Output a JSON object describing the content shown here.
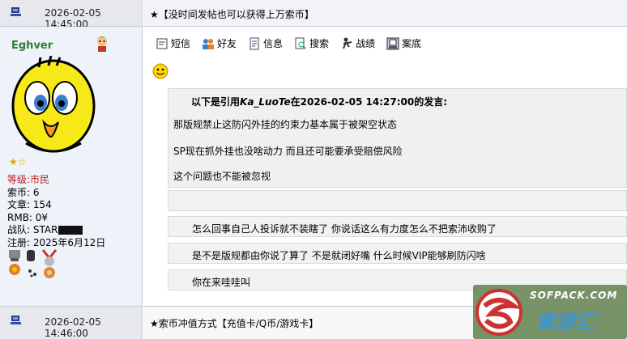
{
  "post1": {
    "date": "2026-02-05 14:45:00",
    "title": "★【没时间发帖也可以获得上万索币】"
  },
  "user": {
    "name": "Eghver",
    "level_label": "等级:",
    "level_value": "市民",
    "coins": "索币: 6",
    "articles": "文章: 154",
    "rmb": "RMB: 0¥",
    "clan": "战队: STAR",
    "joined": "注册: 2025年6月12日"
  },
  "toolbar": {
    "message": "短信",
    "friend": "好友",
    "info": "信息",
    "search": "搜索",
    "record": "战绩",
    "archive": "案底"
  },
  "quote": {
    "header_prefix": "以下是引用",
    "author": "Ka_LuoTe",
    "header_suffix": "在2026-02-05 14:27:00的发言:",
    "line1": "那版规禁止这防闪外挂的约束力基本属于被架空状态",
    "line2": "SP现在抓外挂也没啥动力  而且还可能要承受赔偿风险",
    "line3": "这个问题也不能被忽视"
  },
  "replies": {
    "r1": "怎么回事自己人投诉就不装瞎了 你说话这么有力度怎么不把索沛收购了",
    "r2": "是不是版规都由你说了算了 不是就闭好嘴 什么时候VIP能够刷防闪啥",
    "r3": "你在来哇哇叫"
  },
  "post2": {
    "date": "2026-02-05 14:46:00",
    "title": "★索币冲值方式【充值卡/Q币/游戏卡】"
  },
  "watermark": {
    "site": "SOFPACK.COM",
    "brand": "索游汇"
  },
  "colors": {
    "username": "#2e7d32",
    "level": "#b22222",
    "header_bg": "#e6e8ee"
  }
}
